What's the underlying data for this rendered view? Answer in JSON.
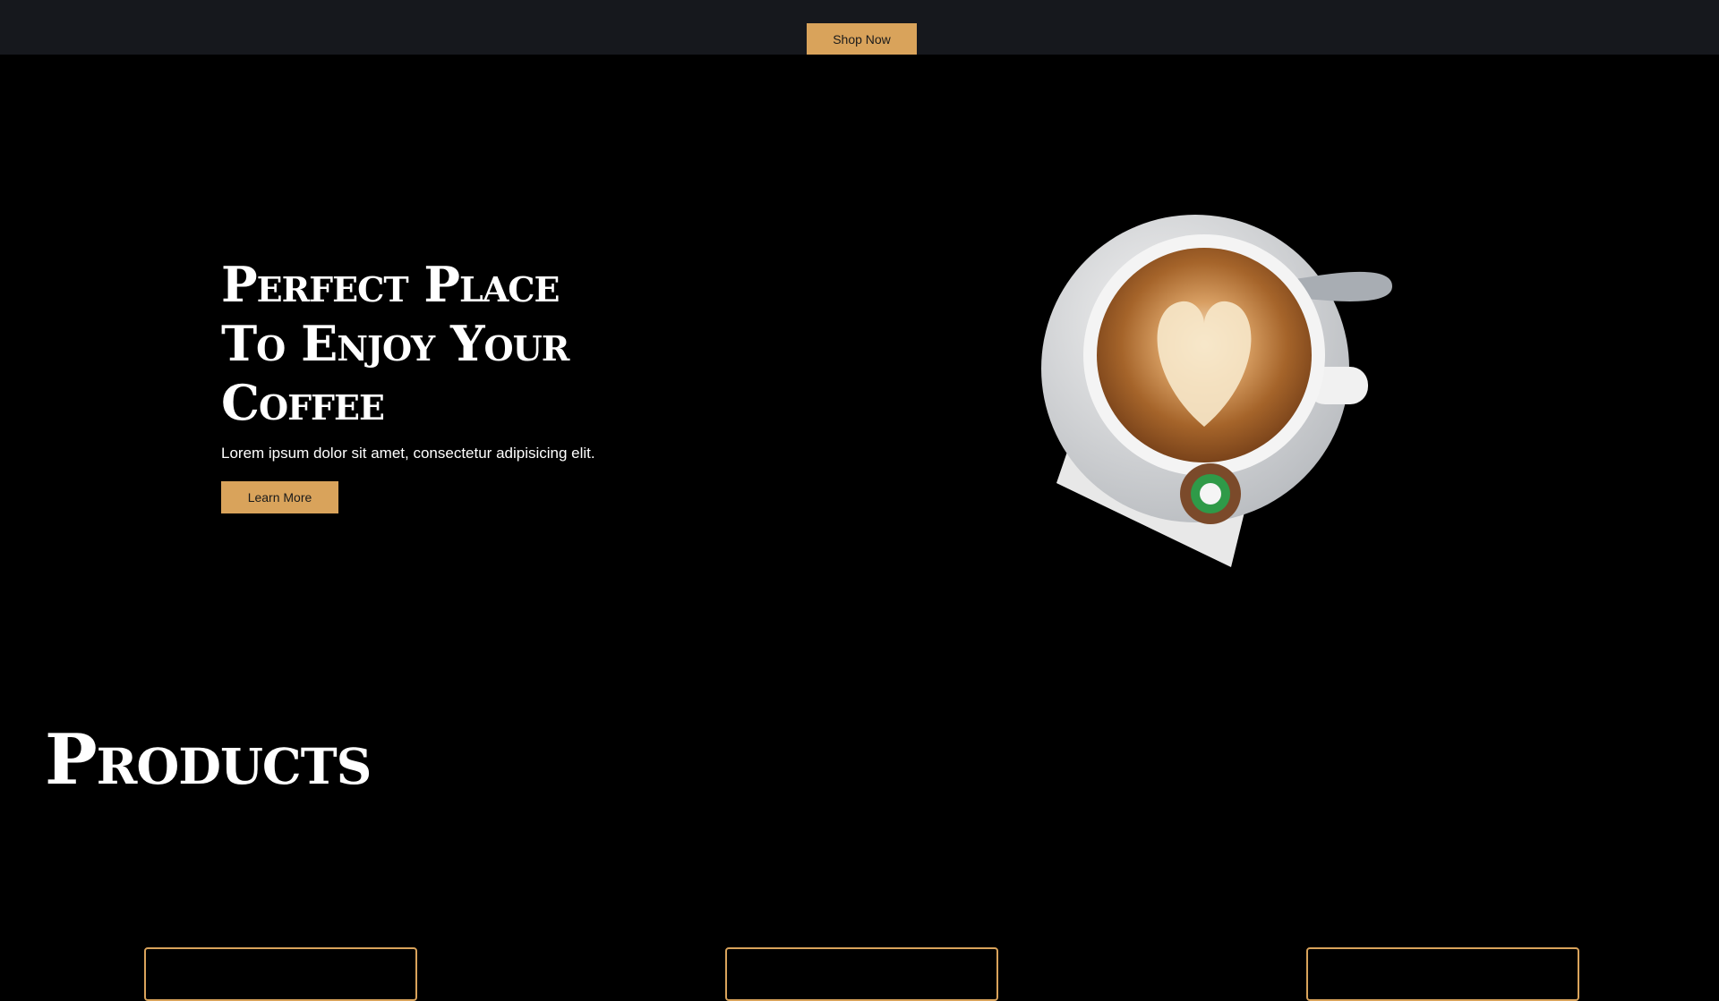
{
  "header": {
    "shop_label": "Shop Now"
  },
  "hero": {
    "title_line1": "Perfect Place",
    "title_line2": "To Enjoy Your",
    "title_line3": "Coffee",
    "subtitle": "Lorem ipsum dolor sit amet, consectetur adipisicing elit.",
    "cta_label": "Learn More"
  },
  "products": {
    "title": "Products",
    "card_count": 3
  },
  "colors": {
    "accent": "#d9a35b",
    "topbar": "#16181d",
    "background": "#000000"
  }
}
